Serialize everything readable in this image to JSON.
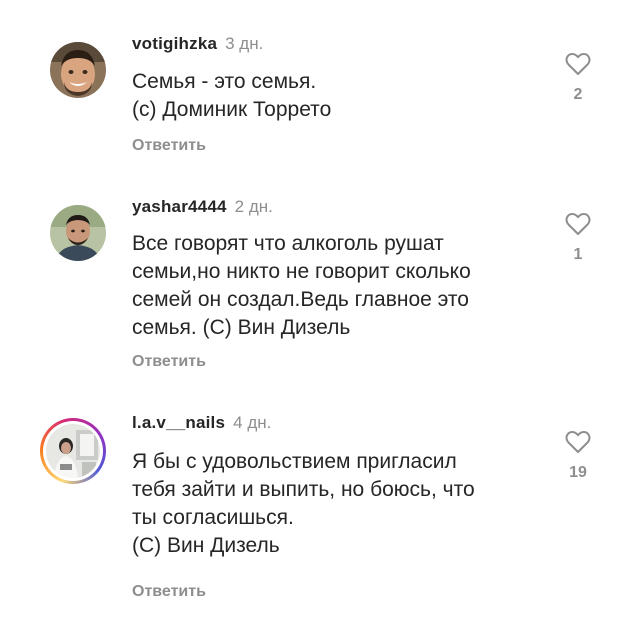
{
  "comments": [
    {
      "username": "votigihzka",
      "time": "3 дн.",
      "text": "Семья - это семья.\n(с) Доминик Торрето",
      "reply_label": "Ответить",
      "likes": "2"
    },
    {
      "username": "yashar4444",
      "time": "2 дн.",
      "text": "Все говорят что алкоголь рушат\nсемьи,но никто не говорит сколько\nсемей он создал.Ведь главное это\nсемья. (С) Вин Дизель",
      "reply_label": "Ответить",
      "likes": "1"
    },
    {
      "username": "l.a.v__nails",
      "time": "4 дн.",
      "text": "Я бы с удовольствием пригласил\nтебя зайти и выпить, но боюсь, что\nты согласишься.\n(С) Вин Дизель",
      "reply_label": "Ответить",
      "likes": "19"
    }
  ],
  "icons": {
    "like": "heart-outline-icon"
  },
  "colors": {
    "text": "#262626",
    "muted": "#8e8e8e"
  }
}
